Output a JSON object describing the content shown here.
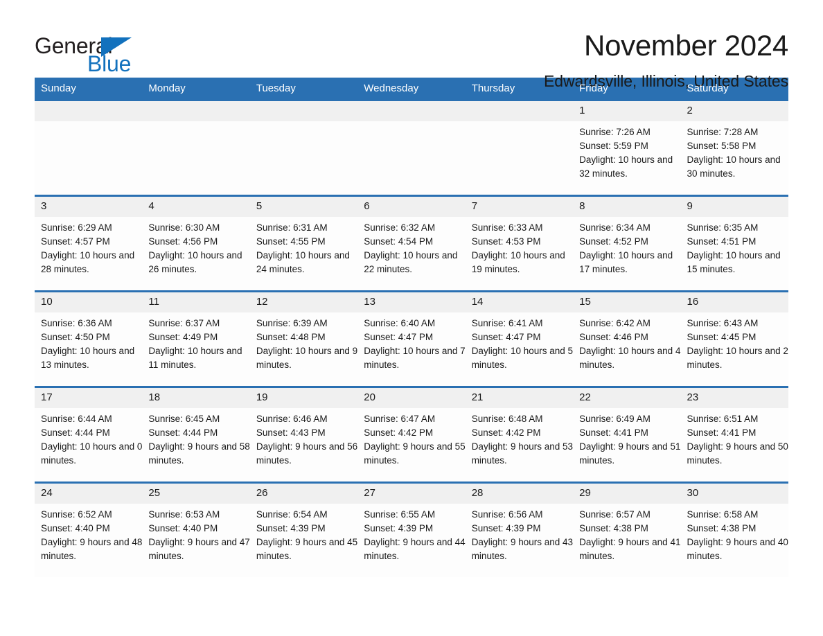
{
  "brand": {
    "name_part1": "General",
    "name_part2": "Blue",
    "accent_color": "#1271bd",
    "triangle_icon": "triangle-icon"
  },
  "header": {
    "month_title": "November 2024",
    "location": "Edwardsville, Illinois, United States"
  },
  "theme": {
    "header_blue": "#2a70b2",
    "daynum_band": "#f0f0f0",
    "cell_background": "#fdfdfd",
    "text_color": "#1a1a1a"
  },
  "weekdays": [
    "Sunday",
    "Monday",
    "Tuesday",
    "Wednesday",
    "Thursday",
    "Friday",
    "Saturday"
  ],
  "weeks": [
    [
      {
        "day": "",
        "details": ""
      },
      {
        "day": "",
        "details": ""
      },
      {
        "day": "",
        "details": ""
      },
      {
        "day": "",
        "details": ""
      },
      {
        "day": "",
        "details": ""
      },
      {
        "day": "1",
        "details": "Sunrise: 7:26 AM\nSunset: 5:59 PM\nDaylight: 10 hours and 32 minutes."
      },
      {
        "day": "2",
        "details": "Sunrise: 7:28 AM\nSunset: 5:58 PM\nDaylight: 10 hours and 30 minutes."
      }
    ],
    [
      {
        "day": "3",
        "details": "Sunrise: 6:29 AM\nSunset: 4:57 PM\nDaylight: 10 hours and 28 minutes."
      },
      {
        "day": "4",
        "details": "Sunrise: 6:30 AM\nSunset: 4:56 PM\nDaylight: 10 hours and 26 minutes."
      },
      {
        "day": "5",
        "details": "Sunrise: 6:31 AM\nSunset: 4:55 PM\nDaylight: 10 hours and 24 minutes."
      },
      {
        "day": "6",
        "details": "Sunrise: 6:32 AM\nSunset: 4:54 PM\nDaylight: 10 hours and 22 minutes."
      },
      {
        "day": "7",
        "details": "Sunrise: 6:33 AM\nSunset: 4:53 PM\nDaylight: 10 hours and 19 minutes."
      },
      {
        "day": "8",
        "details": "Sunrise: 6:34 AM\nSunset: 4:52 PM\nDaylight: 10 hours and 17 minutes."
      },
      {
        "day": "9",
        "details": "Sunrise: 6:35 AM\nSunset: 4:51 PM\nDaylight: 10 hours and 15 minutes."
      }
    ],
    [
      {
        "day": "10",
        "details": "Sunrise: 6:36 AM\nSunset: 4:50 PM\nDaylight: 10 hours and 13 minutes."
      },
      {
        "day": "11",
        "details": "Sunrise: 6:37 AM\nSunset: 4:49 PM\nDaylight: 10 hours and 11 minutes."
      },
      {
        "day": "12",
        "details": "Sunrise: 6:39 AM\nSunset: 4:48 PM\nDaylight: 10 hours and 9 minutes."
      },
      {
        "day": "13",
        "details": "Sunrise: 6:40 AM\nSunset: 4:47 PM\nDaylight: 10 hours and 7 minutes."
      },
      {
        "day": "14",
        "details": "Sunrise: 6:41 AM\nSunset: 4:47 PM\nDaylight: 10 hours and 5 minutes."
      },
      {
        "day": "15",
        "details": "Sunrise: 6:42 AM\nSunset: 4:46 PM\nDaylight: 10 hours and 4 minutes."
      },
      {
        "day": "16",
        "details": "Sunrise: 6:43 AM\nSunset: 4:45 PM\nDaylight: 10 hours and 2 minutes."
      }
    ],
    [
      {
        "day": "17",
        "details": "Sunrise: 6:44 AM\nSunset: 4:44 PM\nDaylight: 10 hours and 0 minutes."
      },
      {
        "day": "18",
        "details": "Sunrise: 6:45 AM\nSunset: 4:44 PM\nDaylight: 9 hours and 58 minutes."
      },
      {
        "day": "19",
        "details": "Sunrise: 6:46 AM\nSunset: 4:43 PM\nDaylight: 9 hours and 56 minutes."
      },
      {
        "day": "20",
        "details": "Sunrise: 6:47 AM\nSunset: 4:42 PM\nDaylight: 9 hours and 55 minutes."
      },
      {
        "day": "21",
        "details": "Sunrise: 6:48 AM\nSunset: 4:42 PM\nDaylight: 9 hours and 53 minutes."
      },
      {
        "day": "22",
        "details": "Sunrise: 6:49 AM\nSunset: 4:41 PM\nDaylight: 9 hours and 51 minutes."
      },
      {
        "day": "23",
        "details": "Sunrise: 6:51 AM\nSunset: 4:41 PM\nDaylight: 9 hours and 50 minutes."
      }
    ],
    [
      {
        "day": "24",
        "details": "Sunrise: 6:52 AM\nSunset: 4:40 PM\nDaylight: 9 hours and 48 minutes."
      },
      {
        "day": "25",
        "details": "Sunrise: 6:53 AM\nSunset: 4:40 PM\nDaylight: 9 hours and 47 minutes."
      },
      {
        "day": "26",
        "details": "Sunrise: 6:54 AM\nSunset: 4:39 PM\nDaylight: 9 hours and 45 minutes."
      },
      {
        "day": "27",
        "details": "Sunrise: 6:55 AM\nSunset: 4:39 PM\nDaylight: 9 hours and 44 minutes."
      },
      {
        "day": "28",
        "details": "Sunrise: 6:56 AM\nSunset: 4:39 PM\nDaylight: 9 hours and 43 minutes."
      },
      {
        "day": "29",
        "details": "Sunrise: 6:57 AM\nSunset: 4:38 PM\nDaylight: 9 hours and 41 minutes."
      },
      {
        "day": "30",
        "details": "Sunrise: 6:58 AM\nSunset: 4:38 PM\nDaylight: 9 hours and 40 minutes."
      }
    ]
  ]
}
